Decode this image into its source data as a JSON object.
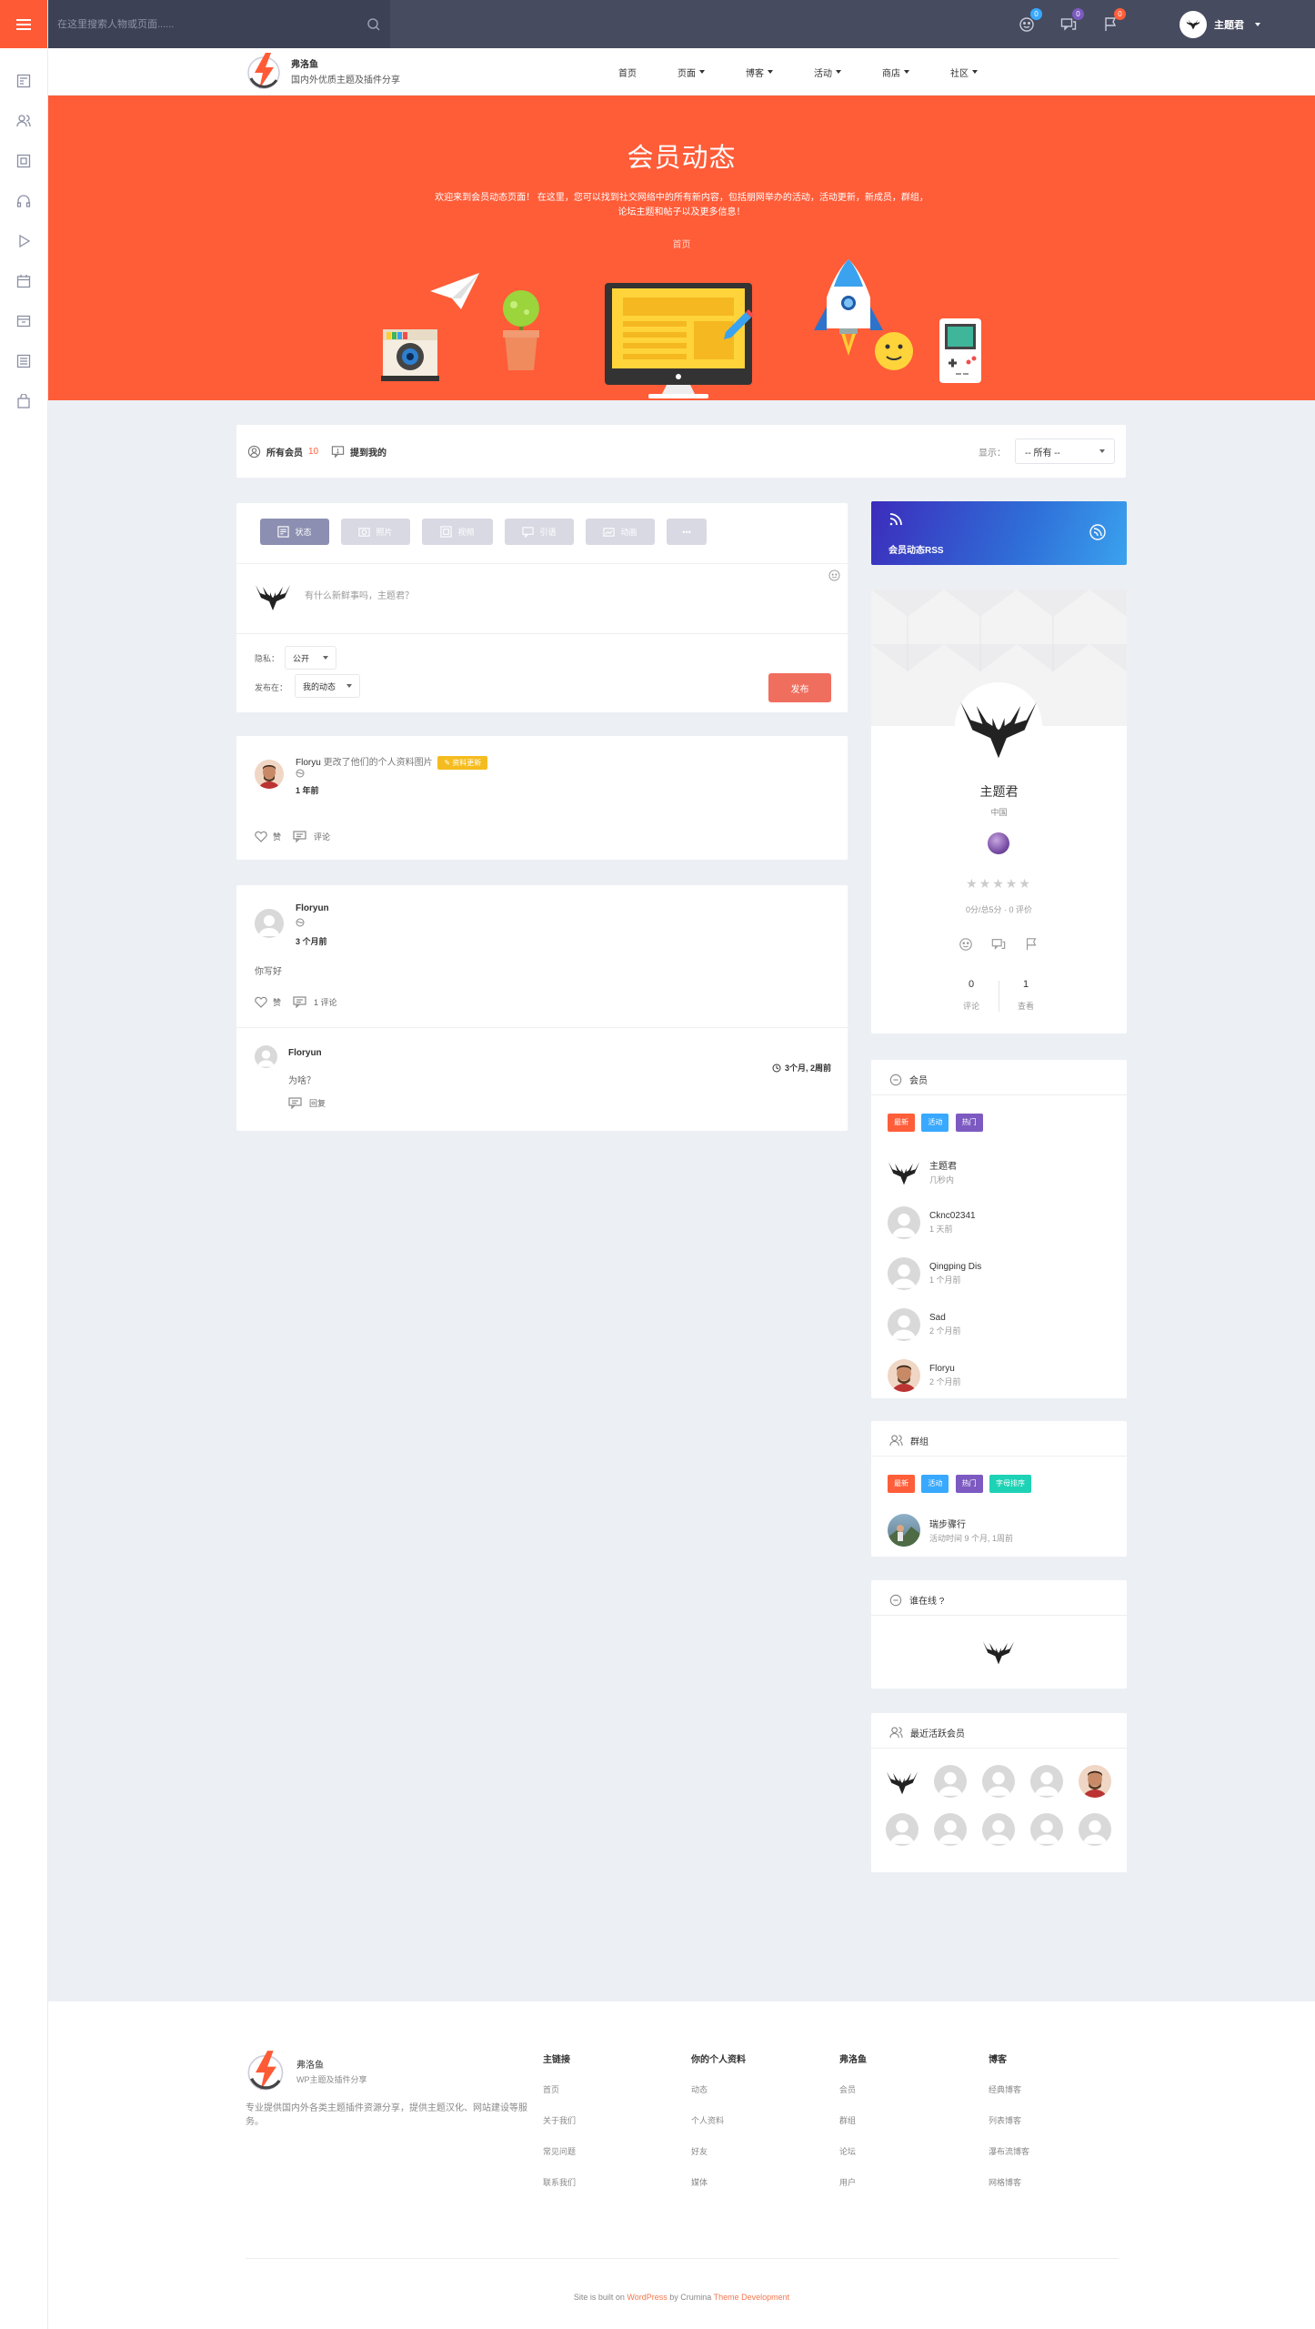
{
  "colors": {
    "accent": "#ff5a36",
    "topbar": "#474b5f",
    "hero": "#ff5c38",
    "tag": "#f5bc1f"
  },
  "search": {
    "placeholder": "在这里搜索人物或页面......"
  },
  "topbar": {
    "badge_comments": "0",
    "badge_messages": "0",
    "badge_notifications": "0",
    "user_name": "主题君"
  },
  "site": {
    "name": "弗洛鱼",
    "tagline": "国内外优质主题及插件分享"
  },
  "nav": {
    "items": [
      "首页",
      "页面",
      "博客",
      "活动",
      "商店",
      "社区"
    ]
  },
  "hero": {
    "title": "会员动态",
    "desc_line1": "欢迎来到会员动态页面！ 在这里，您可以找到社交网络中的所有新内容，包括朋网举办的活动，活动更新，新成员，群组，",
    "desc_line2": "论坛主题和帖子以及更多信息！",
    "crumb": "首页"
  },
  "filter": {
    "all_members": "所有会员",
    "all_count": "10",
    "mentions": "提到我的",
    "show_label": "显示：",
    "show_value": "-- 所有 --"
  },
  "postform": {
    "tabs": [
      "状态",
      "照片",
      "视频",
      "引语",
      "动画",
      "•••"
    ],
    "placeholder": "有什么新鲜事吗，主题君？",
    "privacy_label": "隐私：",
    "privacy_value": "公开",
    "post_in_label": "发布在：",
    "post_in_value": "我的动态",
    "submit": "发布"
  },
  "activity1": {
    "name": "Floryu",
    "action": "更改了他们的个人资料图片",
    "tag": "资料更新",
    "time": "1 年前",
    "like": "赞",
    "comment": "评论"
  },
  "activity2": {
    "name": "Floryun",
    "time": "3 个月前",
    "content": "你写好",
    "like": "赞",
    "comment": "1 评论",
    "reply_name": "Floryun",
    "reply_text": "为啥？",
    "reply_time": "3个月, 2周前",
    "reply_btn": "回复"
  },
  "rss": {
    "label": "会员动态RSS"
  },
  "profile": {
    "name": "主题君",
    "location": "中国",
    "score": "0分/总5分  ·  0 评价",
    "stat1_value": "0",
    "stat1_label": "评论",
    "stat2_value": "1",
    "stat2_label": "查看"
  },
  "members": {
    "title": "会员",
    "tabs": [
      "最新",
      "活动",
      "热门"
    ],
    "list": [
      {
        "name": "主题君",
        "time": "几秒内"
      },
      {
        "name": "Cknc02341",
        "time": "1 天前"
      },
      {
        "name": "Qingping Dis",
        "time": "1 个月前"
      },
      {
        "name": "Sad",
        "time": "2 个月前"
      },
      {
        "name": "Floryu",
        "time": "2 个月前"
      }
    ]
  },
  "groups": {
    "title": "群组",
    "tabs": [
      "最新",
      "活动",
      "热门",
      "字母排序"
    ],
    "item_name": "瑞步骤行",
    "item_time": "活动时间 9 个月, 1周前"
  },
  "online": {
    "title": "谁在线 ?"
  },
  "recent": {
    "title": "最近活跃会员"
  },
  "footer": {
    "site_name": "弗洛鱼",
    "tagline": "WP主题及插件分享",
    "desc": "专业提供国内外各类主题插件资源分享，提供主题汉化、网站建设等服务。",
    "cols": [
      {
        "title": "主链接",
        "links": [
          "首页",
          "关于我们",
          "常见问题",
          "联系我们"
        ]
      },
      {
        "title": "你的个人资料",
        "links": [
          "动态",
          "个人资料",
          "好友",
          "媒体"
        ]
      },
      {
        "title": "弗洛鱼",
        "links": [
          "会员",
          "群组",
          "论坛",
          "用户"
        ]
      },
      {
        "title": "博客",
        "links": [
          "经典博客",
          "列表博客",
          "瀑布流博客",
          "网格博客"
        ]
      }
    ],
    "copy_a": "Site is built on ",
    "copy_wp": "WordPress",
    "copy_b": " by Crumina ",
    "copy_dev": "Theme Development"
  }
}
